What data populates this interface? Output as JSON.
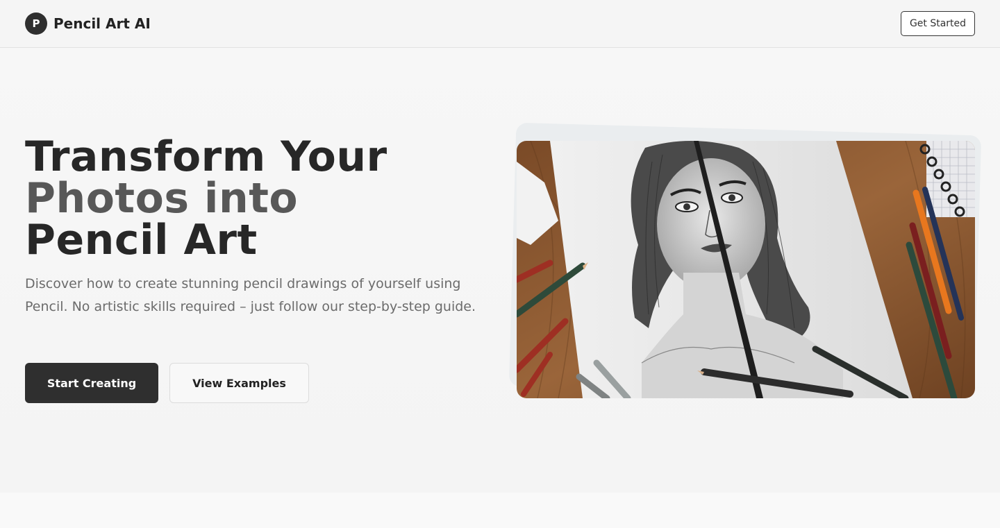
{
  "navbar": {
    "logo_letter": "P",
    "brand_name": "Pencil Art AI",
    "cta_label": "Get Started"
  },
  "hero": {
    "headline_line1": "Transform Your",
    "headline_line2": "Photos into",
    "headline_line3": "Pencil Art",
    "subtext": "Discover how to create stunning pencil drawings of yourself using Pencil. No artistic skills required – just follow our step-by-step guide.",
    "primary_button": "Start Creating",
    "secondary_button": "View Examples"
  },
  "colors": {
    "primary": "#2f2f2f",
    "background": "#f7f7f7",
    "wood": "#8a5a33",
    "paper": "#e6e6e6"
  }
}
